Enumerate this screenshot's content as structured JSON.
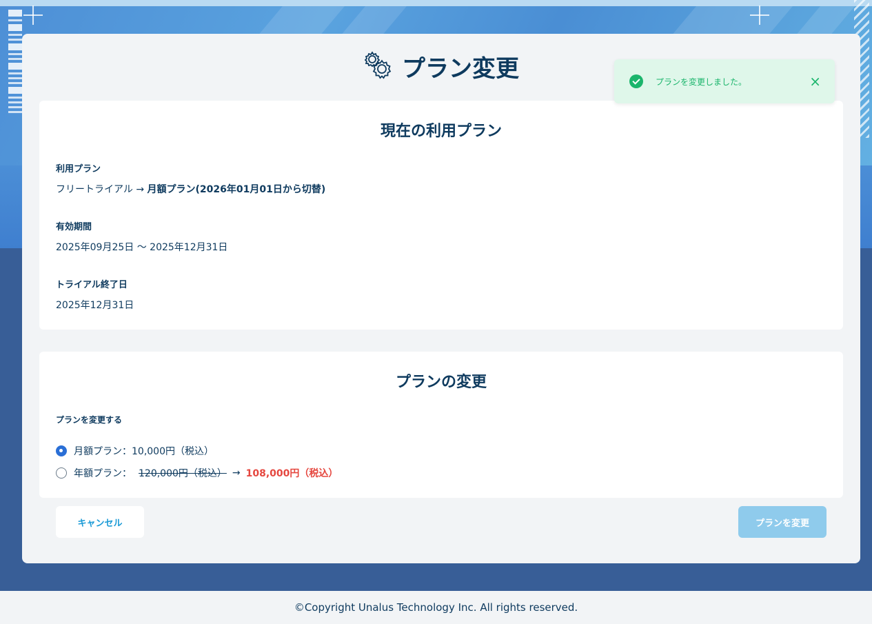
{
  "page": {
    "title": "プラン変更",
    "icon": "gears-icon"
  },
  "current_plan": {
    "title": "現在の利用プラン",
    "plan_label": "利用プラン",
    "plan_from": "フリートライアル",
    "plan_arrow": "→",
    "plan_to": "月額プラン(2026年01月01日から切替)",
    "period_label": "有効期間",
    "period_value": "2025年09月25日 〜 2025年12月31日",
    "trial_end_label": "トライアル終了日",
    "trial_end_value": "2025年12月31日"
  },
  "change_plan": {
    "title": "プランの変更",
    "section_label": "プランを変更する",
    "options": [
      {
        "label": "月額プラン：10,000円（税込）",
        "selected": true
      },
      {
        "label": "年額プラン：",
        "original_price": "120,000円（税込）",
        "arrow": "→",
        "discount_price": "108,000円（税込）",
        "selected": false
      }
    ]
  },
  "actions": {
    "cancel_label": "キャンセル",
    "submit_label": "プランを変更"
  },
  "toast": {
    "message": "プランを変更しました。",
    "close": "×",
    "status_color": "#1bb56c"
  },
  "footer": {
    "text": "©Copyright Unalus Technology Inc. All rights reserved."
  },
  "colors": {
    "primary_text": "#0e3a5e",
    "accent": "#1a9ad6",
    "discount": "#e5473f",
    "radio_selected": "#2a6fd6"
  }
}
